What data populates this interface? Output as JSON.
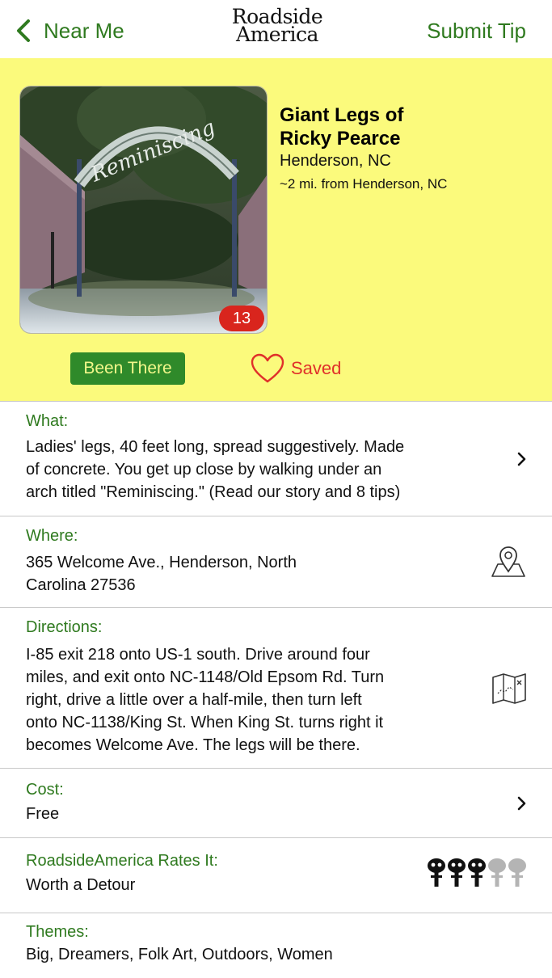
{
  "nav": {
    "back_label": "Near Me",
    "logo_line1": "Roadside",
    "logo_line2": "America",
    "right_label": "Submit Tip"
  },
  "hero": {
    "photo_sign_text": "Reminiscing",
    "photo_count": "13",
    "title_line1": "Giant Legs of",
    "title_line2": "Ricky Pearce",
    "location": "Henderson, NC",
    "distance": "~2 mi. from Henderson, NC",
    "been_there_label": "Been There",
    "saved_label": "Saved"
  },
  "sections": {
    "what": {
      "label": "What:",
      "lines": [
        "Ladies' legs, 40 feet long, spread suggestively. Made",
        "of concrete. You get up close by walking under an",
        "arch titled \"Reminiscing.\" (Read our story and 8 tips)"
      ]
    },
    "where": {
      "label": "Where:",
      "lines": [
        "365 Welcome Ave., Henderson, North",
        "Carolina  27536"
      ]
    },
    "directions": {
      "label": "Directions:",
      "lines": [
        "I-85 exit 218 onto US-1 south. Drive around four",
        "miles, and exit onto NC-1148/Old Epsom Rd. Turn",
        "right, drive a little over a half-mile, then turn left",
        "onto NC-1138/King St. When King St. turns right it",
        "becomes Welcome Ave. The legs will be there."
      ]
    },
    "cost": {
      "label": "Cost:",
      "value": "Free"
    },
    "rating": {
      "label": "RoadsideAmerica Rates It:",
      "value": "Worth a Detour",
      "stars_filled": 3,
      "stars_total": 5
    },
    "themes": {
      "label": "Themes:",
      "value": "Big, Dreamers, Folk Art, Outdoors, Women"
    }
  },
  "colors": {
    "accent_green": "#2f7a1f",
    "header_yellow": "#fbfa7c",
    "badge_red": "#d9251d",
    "saved_red": "#e0302a"
  }
}
